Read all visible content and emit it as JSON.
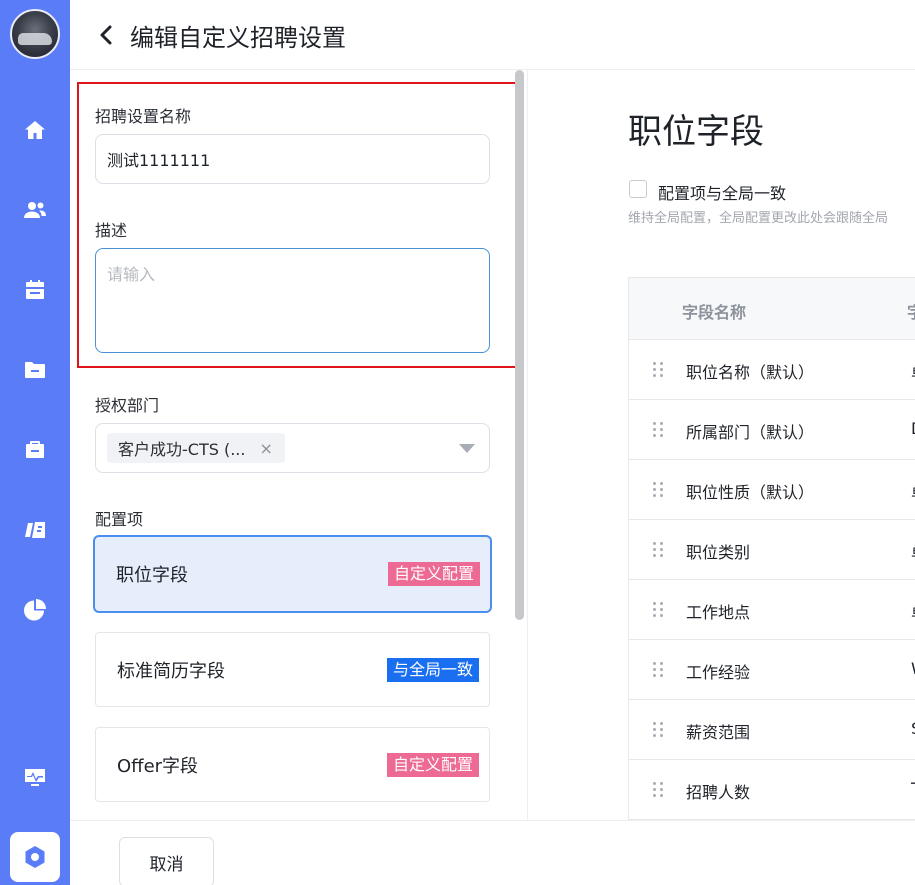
{
  "header": {
    "title": "编辑自定义招聘设置"
  },
  "form": {
    "name_label": "招聘设置名称",
    "name_value": "测试1111111",
    "desc_label": "描述",
    "desc_placeholder": "请输入",
    "dept_label": "授权部门",
    "dept_tag": "客户成功-CTS (...",
    "dept_tag_close": "×",
    "config_label": "配置项"
  },
  "config_items": [
    {
      "name": "职位字段",
      "badge": "自定义配置",
      "badge_color": "#ec6a94",
      "selected": true
    },
    {
      "name": "标准简历字段",
      "badge": "与全局一致",
      "badge_color": "#1a6ff0",
      "selected": false
    },
    {
      "name": "Offer字段",
      "badge": "自定义配置",
      "badge_color": "#ec6a94",
      "selected": false
    }
  ],
  "detail": {
    "title": "职位字段",
    "checkbox_label": "配置项与全局一致",
    "checkbox_checked": false,
    "hint": "维持全局配置，全局配置更改此处会跟随全局",
    "table": {
      "col_name": "字段名称",
      "col_type": "字",
      "rows": [
        {
          "name": "职位名称（默认）",
          "type": "单"
        },
        {
          "name": "所属部门（默认）",
          "type": "D"
        },
        {
          "name": "职位性质（默认）",
          "type": "单"
        },
        {
          "name": "职位类别",
          "type": "单"
        },
        {
          "name": "工作地点",
          "type": "单"
        },
        {
          "name": "工作经验",
          "type": "W"
        },
        {
          "name": "薪资范围",
          "type": "S"
        },
        {
          "name": "招聘人数",
          "type": "T"
        }
      ]
    }
  },
  "footer": {
    "cancel_label": "取消"
  },
  "sidebar": {
    "icons": [
      "home-icon",
      "users-icon",
      "calendar-icon",
      "folder-icon",
      "briefcase-icon",
      "cards-icon",
      "pie-chart-icon",
      "monitor-icon"
    ],
    "accent": "#5b7cf7"
  }
}
